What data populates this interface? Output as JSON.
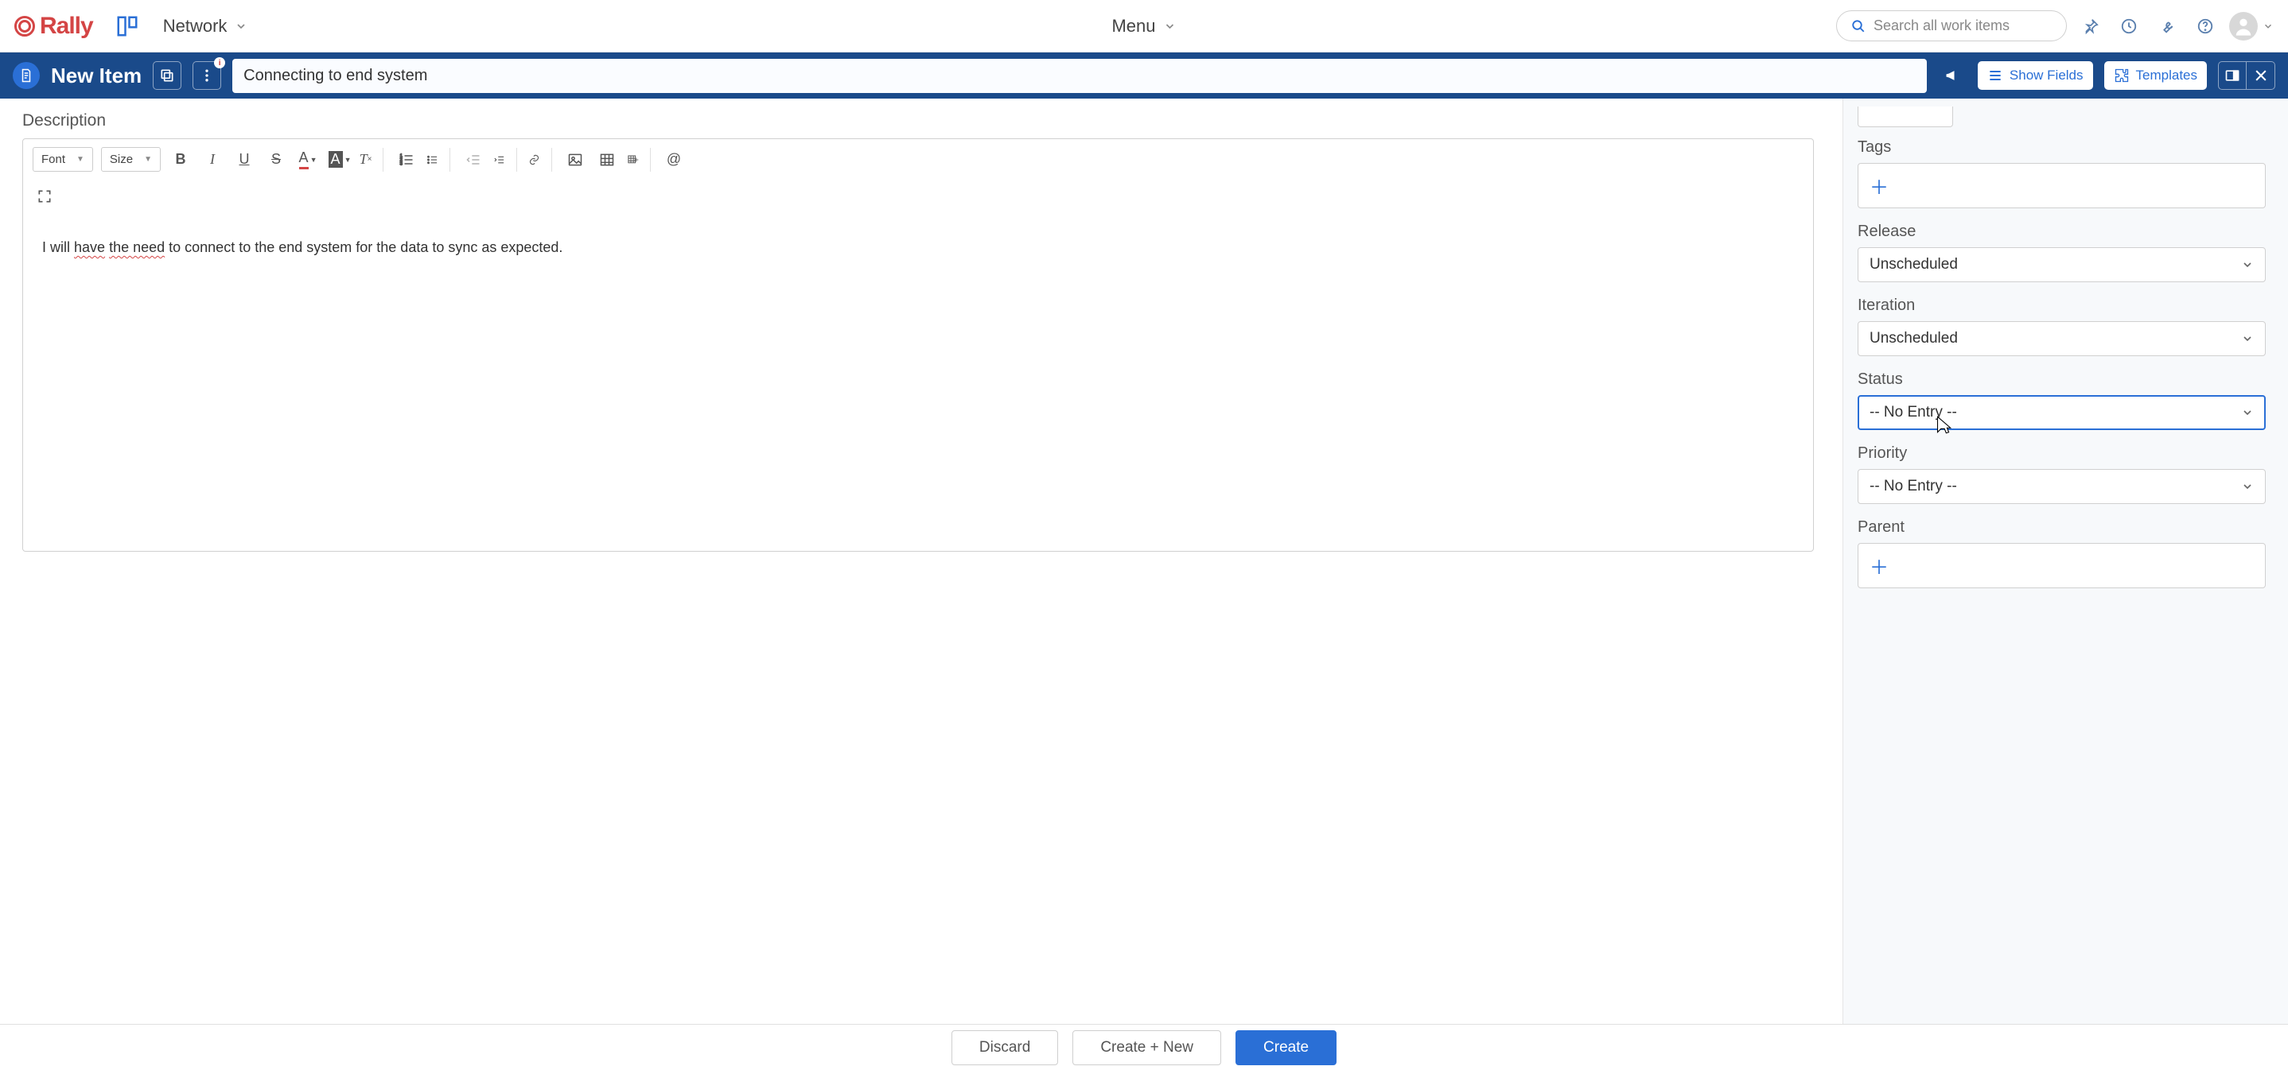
{
  "app": {
    "brand": "Rally",
    "scope": "Network",
    "menu_label": "Menu",
    "search_placeholder": "Search all work items"
  },
  "toolbar": {
    "page_title": "New Item",
    "item_title": "Connecting to end system",
    "show_fields": "Show Fields",
    "templates": "Templates"
  },
  "editor": {
    "section": "Description",
    "font_dd": "Font",
    "size_dd": "Size",
    "body_pre": "I will ",
    "body_u1": "have",
    "body_mid": " ",
    "body_u2": "the need",
    "body_post": " to connect to the end system for the data to sync as expected."
  },
  "sidebar": {
    "tags": {
      "label": "Tags"
    },
    "release": {
      "label": "Release",
      "value": "Unscheduled"
    },
    "iteration": {
      "label": "Iteration",
      "value": "Unscheduled"
    },
    "status": {
      "label": "Status",
      "value": "-- No Entry --"
    },
    "priority": {
      "label": "Priority",
      "value": "-- No Entry --"
    },
    "parent": {
      "label": "Parent"
    }
  },
  "footer": {
    "discard": "Discard",
    "create_new": "Create + New",
    "create": "Create"
  },
  "colors": {
    "brand_red": "#d44545",
    "primary_blue": "#2a6fd6",
    "bar_blue": "#1a4a8a"
  }
}
